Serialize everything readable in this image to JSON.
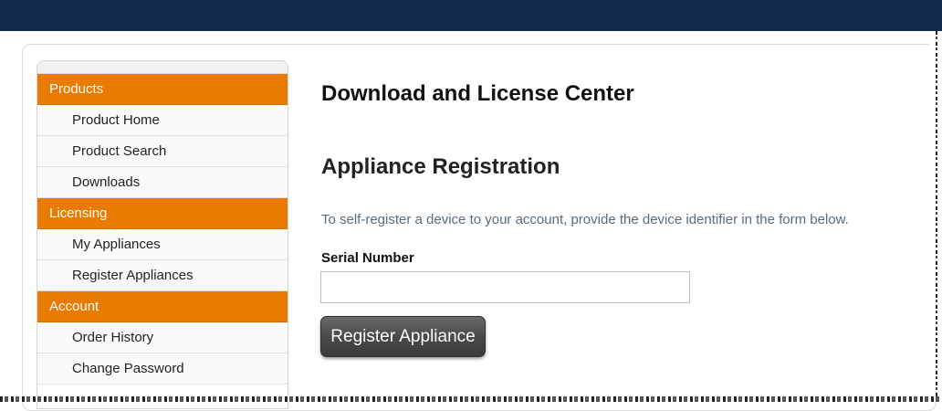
{
  "sidebar": {
    "sections": [
      {
        "header": "Products",
        "items": [
          "Product Home",
          "Product Search",
          "Downloads"
        ]
      },
      {
        "header": "Licensing",
        "items": [
          "My Appliances",
          "Register Appliances"
        ]
      },
      {
        "header": "Account",
        "items": [
          "Order History",
          "Change Password"
        ]
      }
    ]
  },
  "main": {
    "page_title": "Download and License Center",
    "section_title": "Appliance Registration",
    "intro": "To self-register a device to your account, provide the device identifier in the form below.",
    "serial_label": "Serial Number",
    "serial_value": "",
    "register_button": "Register Appliance"
  },
  "colors": {
    "topbar": "#13294b",
    "accent": "#e97b00",
    "button": "#4a4a4a"
  }
}
